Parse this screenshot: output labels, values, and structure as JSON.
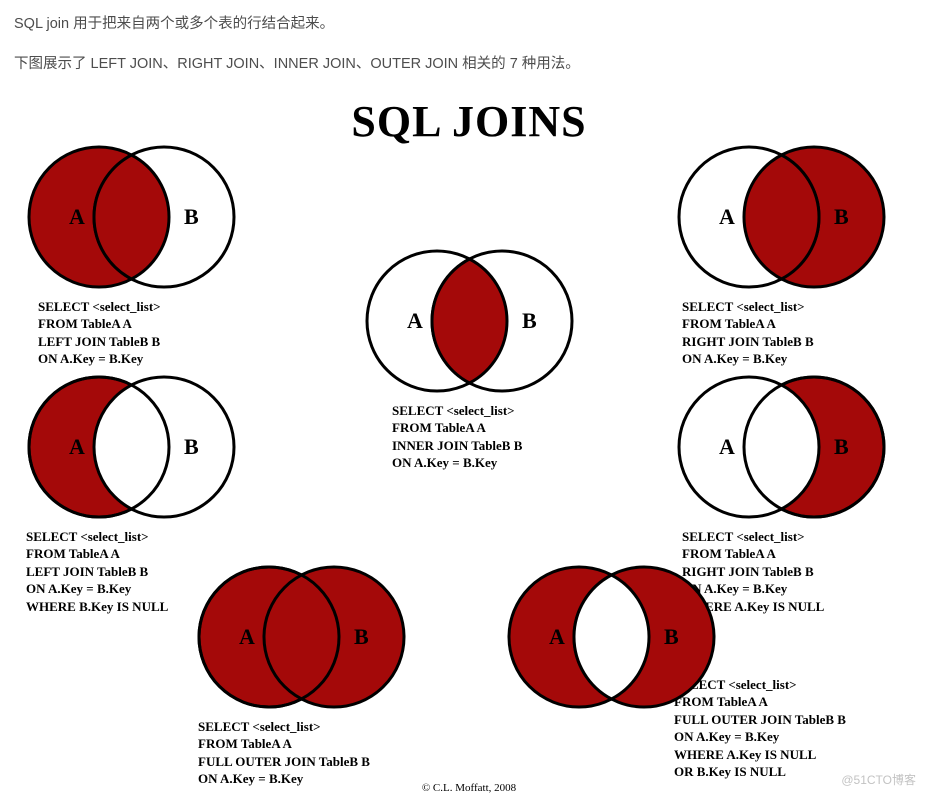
{
  "intro": {
    "line1": "SQL join 用于把来自两个或多个表的行结合起来。",
    "line2": "下图展示了 LEFT JOIN、RIGHT JOIN、INNER JOIN、OUTER JOIN 相关的 7 种用法。"
  },
  "figure": {
    "title": "SQL JOINS",
    "copyright": "© C.L. Moffatt, 2008",
    "watermark": "@51CTO博客",
    "labelA": "A",
    "labelB": "B",
    "colors": {
      "fill": "#a40909",
      "stroke": "#000000",
      "empty": "#ffffff"
    },
    "joins": {
      "left": {
        "sql": "SELECT <select_list>\nFROM TableA A\nLEFT JOIN TableB B\nON A.Key = B.Key"
      },
      "right": {
        "sql": "SELECT <select_list>\nFROM TableA A\nRIGHT JOIN TableB B\nON A.Key = B.Key"
      },
      "inner": {
        "sql": "SELECT <select_list>\nFROM TableA A\nINNER JOIN TableB B\nON A.Key = B.Key"
      },
      "left_excl": {
        "sql": "SELECT <select_list>\nFROM TableA A\nLEFT JOIN TableB B\nON A.Key = B.Key\nWHERE B.Key IS NULL"
      },
      "right_excl": {
        "sql": "SELECT <select_list>\nFROM TableA A\nRIGHT JOIN TableB B\nON A.Key = B.Key\nWHERE A.Key IS NULL"
      },
      "full": {
        "sql": "SELECT <select_list>\nFROM TableA A\nFULL OUTER JOIN TableB B\nON A.Key = B.Key"
      },
      "full_excl": {
        "sql": "SELECT <select_list>\nFROM TableA A\nFULL OUTER JOIN TableB B\nON A.Key = B.Key\nWHERE A.Key IS NULL\nOR B.Key IS NULL"
      }
    }
  }
}
